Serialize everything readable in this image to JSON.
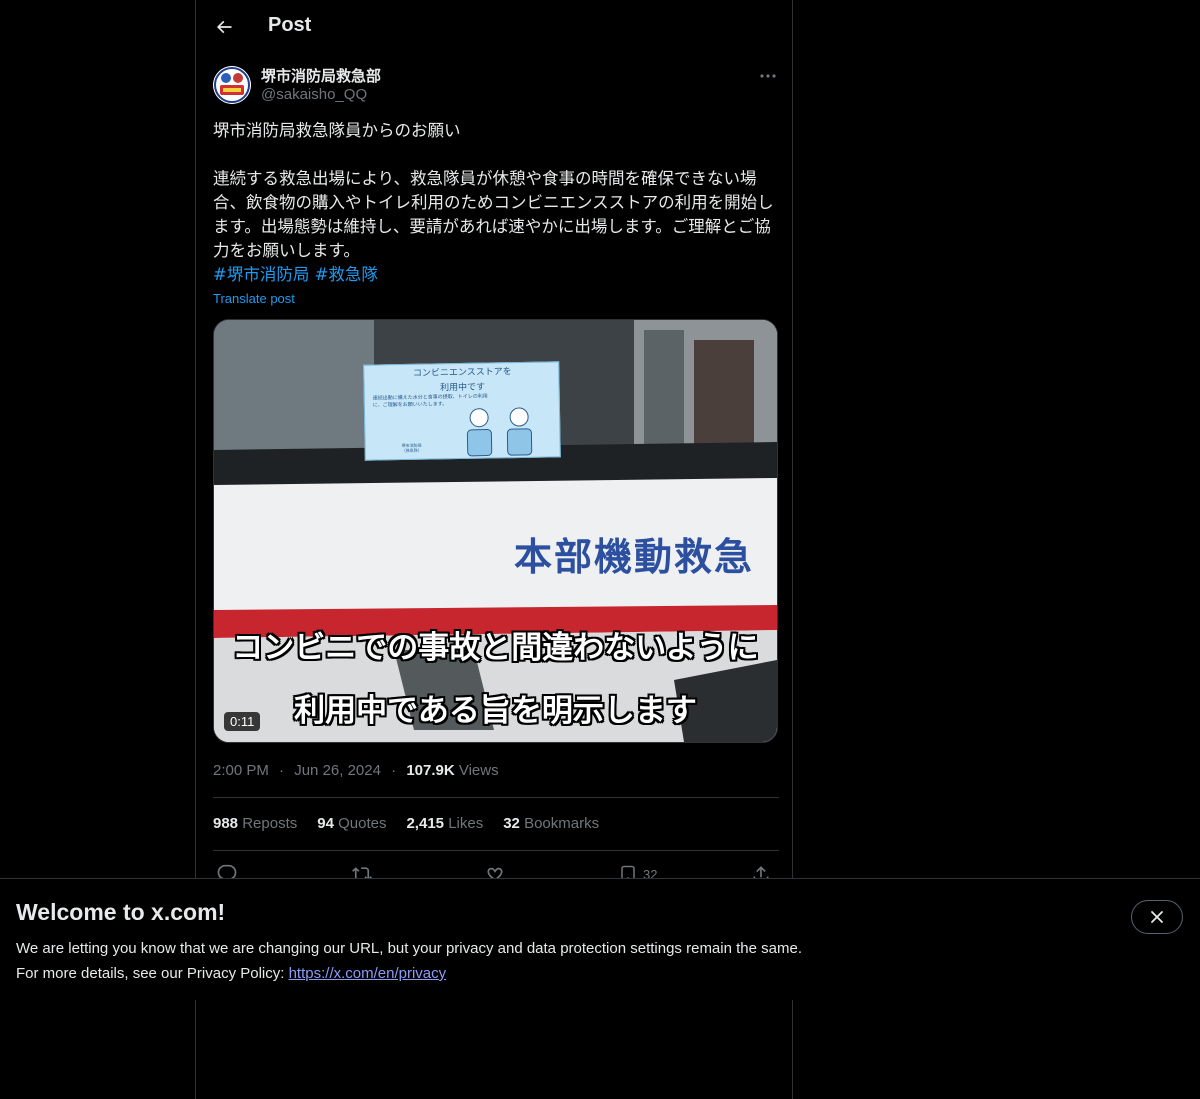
{
  "header": {
    "title": "Post"
  },
  "author": {
    "display_name": "堺市消防局救急部",
    "handle": "@sakaisho_QQ"
  },
  "tweet": {
    "text": "堺市消防局救急隊員からのお願い\n\n連続する救急出場により、救急隊員が休憩や食事の時間を確保できない場合、飲食物の購入やトイレ利用のためコンビニエンスストアの利用を開始します。出場態勢は維持し、要請があれば速やかに出場します。ご理解とご協力をお願いします。",
    "hashtags": [
      "#堺市消防局",
      "#救急隊"
    ],
    "translate_label": "Translate post"
  },
  "media": {
    "sticker_title": "コンビニエンスストアを",
    "sticker_subtitle": "利用中です",
    "sticker_body": "連続出動に備えた水分と食事の摂取、トイレの利用に、ご理解をお願いいたします。",
    "sticker_footer": "堺市消防局\n（救急隊）",
    "vehicle_text": "本部機動救急",
    "subtitle_line1": "コンビニでの事故と間違わないように",
    "subtitle_line2": "利用中である旨を明示します",
    "duration": "0:11"
  },
  "meta": {
    "time": "2:00 PM",
    "separator": "·",
    "date": "Jun 26, 2024",
    "views_count": "107.9K",
    "views_label": "Views"
  },
  "stats": [
    {
      "count": "988",
      "label": "Reposts"
    },
    {
      "count": "94",
      "label": "Quotes"
    },
    {
      "count": "2,415",
      "label": "Likes"
    },
    {
      "count": "32",
      "label": "Bookmarks"
    }
  ],
  "actions": {
    "bookmark_count": "32"
  },
  "banner": {
    "title": "Welcome to x.com!",
    "line1": "We are letting you know that we are changing our URL, but your privacy and data protection settings remain the same.",
    "line2_prefix": "For more details, see our Privacy Policy: ",
    "link": "https://x.com/en/privacy"
  },
  "colors": {
    "accent": "#1d9bf0",
    "background": "#000000",
    "text": "#e7e9ea",
    "muted": "#71767b",
    "link_visited": "#8b9cf7"
  }
}
